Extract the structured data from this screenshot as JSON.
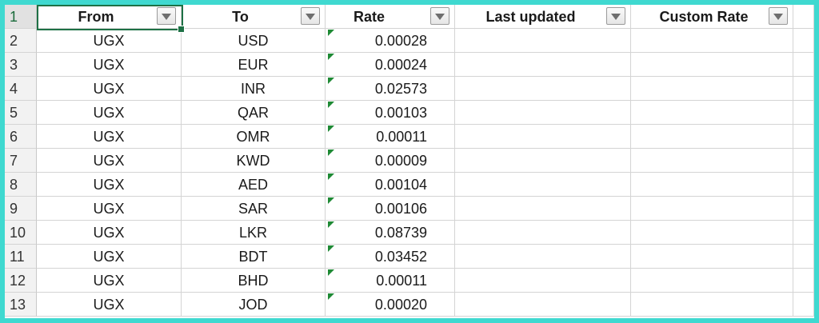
{
  "headers": {
    "row_num": "1",
    "from": "From",
    "to": "To",
    "rate": "Rate",
    "last_updated": "Last updated",
    "custom_rate": "Custom Rate"
  },
  "rows": [
    {
      "num": "2",
      "from": "UGX",
      "to": "USD",
      "rate": "0.00028",
      "last_updated": "",
      "custom_rate": ""
    },
    {
      "num": "3",
      "from": "UGX",
      "to": "EUR",
      "rate": "0.00024",
      "last_updated": "",
      "custom_rate": ""
    },
    {
      "num": "4",
      "from": "UGX",
      "to": "INR",
      "rate": "0.02573",
      "last_updated": "",
      "custom_rate": ""
    },
    {
      "num": "5",
      "from": "UGX",
      "to": "QAR",
      "rate": "0.00103",
      "last_updated": "",
      "custom_rate": ""
    },
    {
      "num": "6",
      "from": "UGX",
      "to": "OMR",
      "rate": "0.00011",
      "last_updated": "",
      "custom_rate": ""
    },
    {
      "num": "7",
      "from": "UGX",
      "to": "KWD",
      "rate": "0.00009",
      "last_updated": "",
      "custom_rate": ""
    },
    {
      "num": "8",
      "from": "UGX",
      "to": "AED",
      "rate": "0.00104",
      "last_updated": "",
      "custom_rate": ""
    },
    {
      "num": "9",
      "from": "UGX",
      "to": "SAR",
      "rate": "0.00106",
      "last_updated": "",
      "custom_rate": ""
    },
    {
      "num": "10",
      "from": "UGX",
      "to": "LKR",
      "rate": "0.08739",
      "last_updated": "",
      "custom_rate": ""
    },
    {
      "num": "11",
      "from": "UGX",
      "to": "BDT",
      "rate": "0.03452",
      "last_updated": "",
      "custom_rate": ""
    },
    {
      "num": "12",
      "from": "UGX",
      "to": "BHD",
      "rate": "0.00011",
      "last_updated": "",
      "custom_rate": ""
    },
    {
      "num": "13",
      "from": "UGX",
      "to": "JOD",
      "rate": "0.00020",
      "last_updated": "",
      "custom_rate": ""
    }
  ],
  "colors": {
    "frame": "#3fd9d0",
    "selection": "#1e7145",
    "text_flag": "#1f8a35"
  },
  "icons": {
    "filter": "filter-dropdown-icon",
    "number_as_text": "number-stored-as-text-flag-icon"
  }
}
